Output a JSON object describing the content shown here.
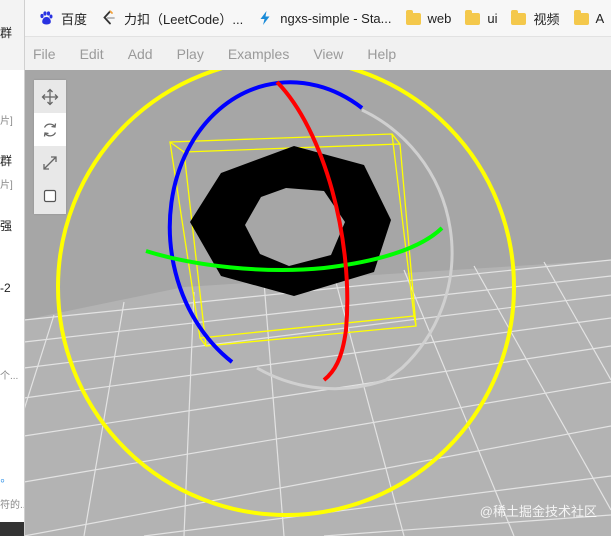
{
  "bookmarks": [
    {
      "label": "百度",
      "icon": "paw-icon"
    },
    {
      "label": "力扣（LeetCode）...",
      "icon": "leetcode-icon"
    },
    {
      "label": "ngxs-simple - Sta...",
      "icon": "lightning-icon"
    },
    {
      "label": "web",
      "icon": "folder-icon"
    },
    {
      "label": "ui",
      "icon": "folder-icon"
    },
    {
      "label": "视频",
      "icon": "folder-icon"
    },
    {
      "label": "A",
      "icon": "folder-icon"
    }
  ],
  "menu": [
    "File",
    "Edit",
    "Add",
    "Play",
    "Examples",
    "View",
    "Help"
  ],
  "tools": [
    {
      "name": "translate-tool",
      "icon": "move-arrows-icon",
      "active": false
    },
    {
      "name": "rotate-tool",
      "icon": "rotate-icon",
      "active": true
    },
    {
      "name": "scale-tool",
      "icon": "scale-arrows-icon",
      "active": false
    },
    {
      "name": "local-space-toggle",
      "icon": "checkbox-icon",
      "active": false
    }
  ],
  "left_panel": {
    "texts": [
      "群",
      "片]",
      "群",
      "片]",
      "强",
      "-2",
      "个...",
      "符的..."
    ]
  },
  "watermark": "@稀土掘金技术社区",
  "colors": {
    "gizmo_x": "#ff0000",
    "gizmo_y": "#00ff00",
    "gizmo_z": "#0000ff",
    "gizmo_outer": "#ffff00",
    "bbox": "#ffff00",
    "mesh": "#000000",
    "background": "#a6a6a6"
  }
}
